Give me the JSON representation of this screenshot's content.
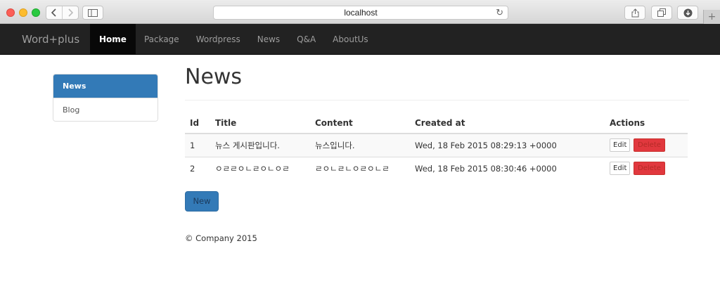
{
  "browser": {
    "url": "localhost",
    "new_tab": "+"
  },
  "navbar": {
    "brand": "Word+plus",
    "items": [
      {
        "label": "Home",
        "active": true
      },
      {
        "label": "Package",
        "active": false
      },
      {
        "label": "Wordpress",
        "active": false
      },
      {
        "label": "News",
        "active": false
      },
      {
        "label": "Q&A",
        "active": false
      },
      {
        "label": "AboutUs",
        "active": false
      }
    ]
  },
  "sidebar": {
    "items": [
      {
        "label": "News",
        "active": true
      },
      {
        "label": "Blog",
        "active": false
      }
    ]
  },
  "main": {
    "title": "News",
    "table": {
      "headers": [
        "Id",
        "Title",
        "Content",
        "Created at",
        "Actions"
      ],
      "rows": [
        {
          "id": "1",
          "title": "뉴스 게시판입니다.",
          "content": "뉴스입니다.",
          "created_at": "Wed, 18 Feb 2015 08:29:13 +0000",
          "edit": "Edit",
          "delete": "Delete"
        },
        {
          "id": "2",
          "title": "ㅇㄹㄹㅇㄴㄹㅇㄴㅇㄹ",
          "content": "ㄹㅇㄴㄹㄴㅇㄹㅇㄴㄹ",
          "created_at": "Wed, 18 Feb 2015 08:30:46 +0000",
          "edit": "Edit",
          "delete": "Delete"
        }
      ]
    },
    "new_button": "New"
  },
  "footer": {
    "text": "© Company 2015"
  },
  "colors": {
    "navbar_bg": "#222222",
    "primary": "#337ab7",
    "danger": "#e1383e"
  }
}
